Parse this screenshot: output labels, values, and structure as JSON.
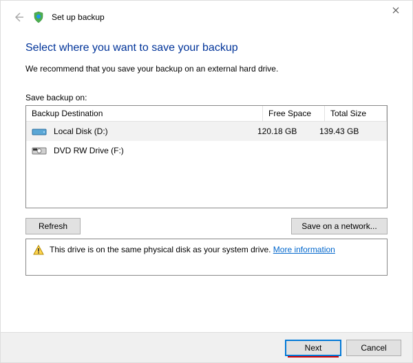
{
  "window": {
    "title": "Set up backup"
  },
  "heading": "Select where you want to save your backup",
  "recommend_text": "We recommend that you save your backup on an external hard drive.",
  "save_label": "Save backup on:",
  "columns": {
    "destination": "Backup Destination",
    "free": "Free Space",
    "total": "Total Size"
  },
  "drives": [
    {
      "icon": "hdd",
      "name": "Local Disk (D:)",
      "free": "120.18 GB",
      "total": "139.43 GB",
      "selected": true
    },
    {
      "icon": "dvd",
      "name": "DVD RW Drive (F:)",
      "free": "",
      "total": "",
      "selected": false
    }
  ],
  "buttons": {
    "refresh": "Refresh",
    "save_network": "Save on a network...",
    "next": "Next",
    "cancel": "Cancel"
  },
  "warning": {
    "text": "This drive is on the same physical disk as your system drive.",
    "link": "More information"
  }
}
